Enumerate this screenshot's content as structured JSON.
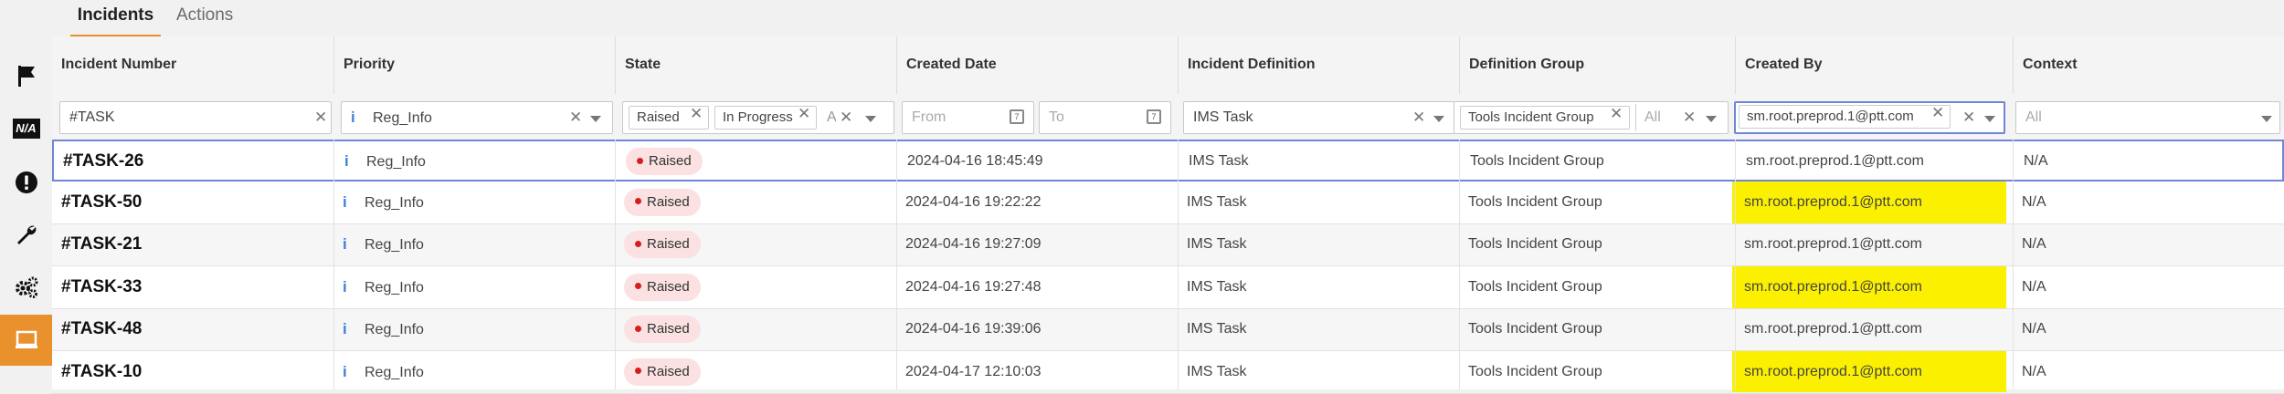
{
  "tabs": [
    {
      "label": "Incidents",
      "active": true
    },
    {
      "label": "Actions",
      "active": false
    }
  ],
  "sidebar": {
    "items": [
      {
        "name": "flag-icon",
        "active": false
      },
      {
        "name": "na-icon",
        "label": "N/A",
        "active": false
      },
      {
        "name": "alert-icon",
        "active": false
      },
      {
        "name": "wrench-icon",
        "active": false
      },
      {
        "name": "gears-icon",
        "active": false
      },
      {
        "name": "monitor-icon",
        "active": true
      }
    ],
    "accent_color": "#e8912d"
  },
  "columns": [
    "Incident Number",
    "Priority",
    "State",
    "Created Date",
    "Incident Definition",
    "Definition Group",
    "Created By",
    "Context"
  ],
  "filters": {
    "incident_number": "#TASK",
    "priority": "Reg_Info",
    "state_chips": [
      "Raised",
      "In Progress",
      "A"
    ],
    "date_from_placeholder": "From",
    "date_to_placeholder": "To",
    "incident_definition": "IMS Task",
    "definition_group_chip": "Tools Incident Group",
    "definition_group_all": "All",
    "created_by": "sm.root.preprod.1@ptt.com",
    "context_placeholder": "All"
  },
  "rows": [
    {
      "number": "#TASK-26",
      "priority": "Reg_Info",
      "state": "Raised",
      "created": "2024-04-16 18:45:49",
      "definition": "IMS Task",
      "group": "Tools Incident Group",
      "created_by": "sm.root.preprod.1@ptt.com",
      "context": "N/A"
    },
    {
      "number": "#TASK-50",
      "priority": "Reg_Info",
      "state": "Raised",
      "created": "2024-04-16 19:22:22",
      "definition": "IMS Task",
      "group": "Tools Incident Group",
      "created_by": "sm.root.preprod.1@ptt.com",
      "context": "N/A"
    },
    {
      "number": "#TASK-21",
      "priority": "Reg_Info",
      "state": "Raised",
      "created": "2024-04-16 19:27:09",
      "definition": "IMS Task",
      "group": "Tools Incident Group",
      "created_by": "sm.root.preprod.1@ptt.com",
      "context": "N/A"
    },
    {
      "number": "#TASK-33",
      "priority": "Reg_Info",
      "state": "Raised",
      "created": "2024-04-16 19:27:48",
      "definition": "IMS Task",
      "group": "Tools Incident Group",
      "created_by": "sm.root.preprod.1@ptt.com",
      "context": "N/A"
    },
    {
      "number": "#TASK-48",
      "priority": "Reg_Info",
      "state": "Raised",
      "created": "2024-04-16 19:39:06",
      "definition": "IMS Task",
      "group": "Tools Incident Group",
      "created_by": "sm.root.preprod.1@ptt.com",
      "context": "N/A"
    },
    {
      "number": "#TASK-10",
      "priority": "Reg_Info",
      "state": "Raised",
      "created": "2024-04-17 12:10:03",
      "definition": "IMS Task",
      "group": "Tools Incident Group",
      "created_by": "sm.root.preprod.1@ptt.com",
      "context": "N/A"
    }
  ],
  "colors": {
    "highlight": "#fbf000",
    "raised_badge_bg": "#fbe1e1",
    "raised_dot": "#d61e1e",
    "info_icon": "#3b82d6",
    "selection": "#6f86d6"
  }
}
